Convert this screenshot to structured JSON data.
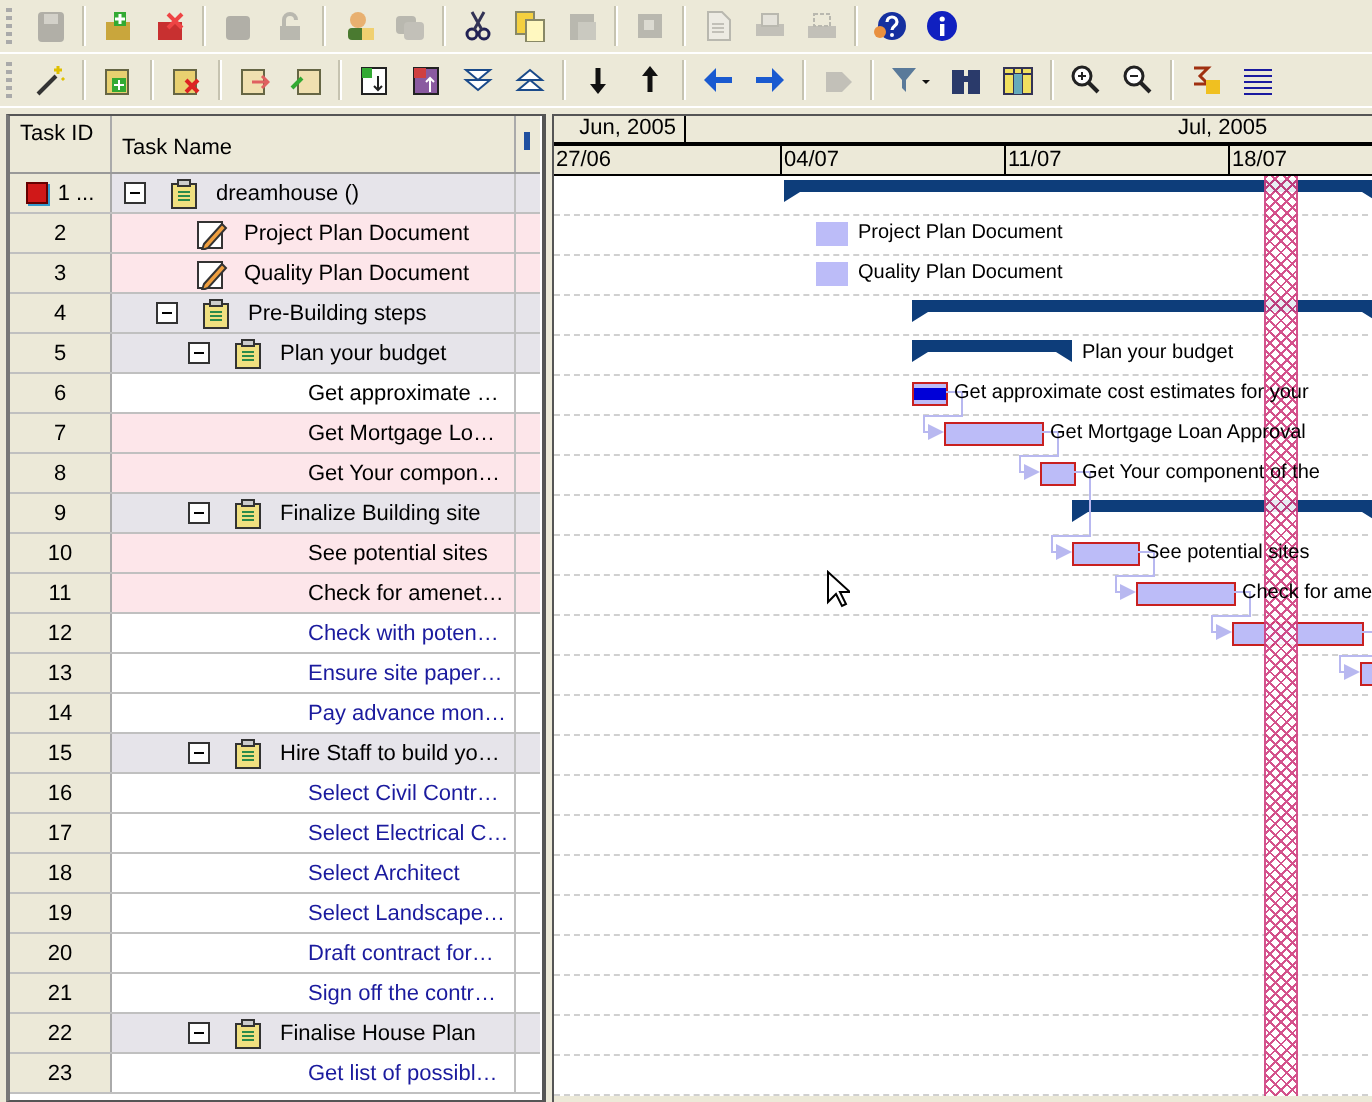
{
  "toolbars": [
    {
      "groups": [
        [
          {
            "disabled": true
          }
        ],
        [
          {
            "disabled": false
          },
          {
            "disabled": false
          }
        ],
        [
          {
            "disabled": true
          },
          {
            "disabled": true
          }
        ],
        [
          {
            "disabled": false
          },
          {
            "disabled": true
          }
        ],
        [
          {
            "disabled": false
          },
          {
            "disabled": false
          },
          {
            "disabled": true
          }
        ],
        [
          {
            "disabled": true
          }
        ],
        [
          {
            "disabled": true
          },
          {
            "disabled": true
          },
          {
            "disabled": true
          }
        ],
        [
          {
            "disabled": false
          },
          {
            "disabled": false
          }
        ]
      ]
    },
    {
      "groups": [
        [
          {
            "disabled": false
          }
        ],
        [
          {
            "disabled": false
          }
        ],
        [
          {
            "disabled": false
          }
        ],
        [
          {
            "disabled": false
          },
          {
            "disabled": false
          }
        ],
        [
          {
            "disabled": false
          },
          {
            "disabled": false
          },
          {
            "disabled": false
          },
          {
            "disabled": false
          }
        ],
        [
          {
            "disabled": false
          },
          {
            "disabled": false
          }
        ],
        [
          {
            "disabled": false
          },
          {
            "disabled": false
          }
        ],
        [
          {
            "disabled": true
          }
        ],
        [
          {
            "disabled": false
          },
          {
            "disabled": false
          },
          {
            "disabled": false
          }
        ],
        [
          {
            "disabled": false
          },
          {
            "disabled": false
          }
        ],
        [
          {
            "disabled": false
          },
          {
            "disabled": false
          }
        ]
      ]
    }
  ],
  "grid": {
    "columns": [
      "Task ID",
      "Task Name"
    ],
    "rows": [
      {
        "id": "1 ...",
        "name": "dreamhouse ()",
        "kind": "project",
        "pending": false,
        "expanded": true,
        "bar": {
          "kind": "summary"
        },
        "children": [
          {
            "id": "2",
            "name": "Project Plan Document",
            "kind": "document",
            "critical": true,
            "pending": false,
            "bar": {
              "kind": "document",
              "label": "Project Plan Document"
            }
          },
          {
            "id": "3",
            "name": "Quality Plan Document",
            "kind": "document",
            "critical": true,
            "pending": false,
            "bar": {
              "kind": "document",
              "label": "Quality Plan Document"
            }
          },
          {
            "id": "4",
            "name": "Pre-Building steps",
            "kind": "summary",
            "pending": false,
            "expanded": true,
            "bar": {
              "kind": "summary"
            },
            "children": [
              {
                "id": "5",
                "name": "Plan your budget",
                "kind": "summary",
                "pending": false,
                "expanded": true,
                "bar": {
                  "kind": "summary",
                  "label": "Plan your budget"
                },
                "children": [
                  {
                    "id": "6",
                    "name": "Get approximate …",
                    "kind": "task",
                    "critical": false,
                    "pending": false,
                    "bar": {
                      "kind": "task",
                      "level": 1,
                      "label": "Get approximate cost estimates for your"
                    }
                  },
                  {
                    "id": "7",
                    "name": "Get Mortgage Lo…",
                    "kind": "task",
                    "critical": true,
                    "pending": false,
                    "bar": {
                      "kind": "task",
                      "label": "Get Mortgage Loan Approval"
                    }
                  },
                  {
                    "id": "8",
                    "name": "Get Your compon…",
                    "kind": "task",
                    "critical": true,
                    "pending": false,
                    "bar": {
                      "kind": "task",
                      "label": "Get Your component of the"
                    }
                  }
                ]
              },
              {
                "id": "9",
                "name": "Finalize Building site",
                "kind": "summary",
                "pending": false,
                "expanded": true,
                "bar": {
                  "kind": "summary"
                },
                "children": [
                  {
                    "id": "10",
                    "name": "See potential sites",
                    "kind": "task",
                    "critical": true,
                    "pending": false,
                    "bar": {
                      "kind": "task",
                      "label": "See potential sites"
                    }
                  },
                  {
                    "id": "11",
                    "name": "Check for amenet…",
                    "kind": "task",
                    "critical": true,
                    "pending": false,
                    "bar": {
                      "kind": "task",
                      "label": "Check for ame"
                    }
                  },
                  {
                    "id": "12",
                    "name": "Check with poten…",
                    "kind": "task",
                    "critical": false,
                    "pending": true,
                    "bar": {
                      "kind": "task"
                    }
                  },
                  {
                    "id": "13",
                    "name": "Ensure site paper…",
                    "kind": "task",
                    "critical": false,
                    "pending": true,
                    "bar": {
                      "kind": "task"
                    }
                  },
                  {
                    "id": "14",
                    "name": "Pay advance mon…",
                    "kind": "task",
                    "critical": false,
                    "pending": true
                  }
                ]
              },
              {
                "id": "15",
                "name": "Hire Staff to build yo…",
                "kind": "summary",
                "pending": false,
                "expanded": true,
                "children": [
                  {
                    "id": "16",
                    "name": "Select Civil Contr…",
                    "kind": "task",
                    "critical": false,
                    "pending": true
                  },
                  {
                    "id": "17",
                    "name": "Select Electrical C…",
                    "kind": "task",
                    "critical": false,
                    "pending": true
                  },
                  {
                    "id": "18",
                    "name": "Select Architect",
                    "kind": "task",
                    "critical": false,
                    "pending": true
                  },
                  {
                    "id": "19",
                    "name": "Select Landscape…",
                    "kind": "task",
                    "critical": false,
                    "pending": true
                  },
                  {
                    "id": "20",
                    "name": "Draft contract for…",
                    "kind": "task",
                    "critical": false,
                    "pending": true
                  },
                  {
                    "id": "21",
                    "name": "Sign off the contr…",
                    "kind": "task",
                    "critical": false,
                    "pending": true
                  }
                ]
              },
              {
                "id": "22",
                "name": "Finalise House Plan",
                "kind": "summary",
                "pending": false,
                "expanded": true,
                "children": [
                  {
                    "id": "23",
                    "name": "Get list of possibl…",
                    "kind": "task",
                    "critical": false,
                    "pending": true
                  }
                ]
              }
            ]
          }
        ]
      }
    ]
  },
  "gantt": {
    "months": [
      "Jun, 2005",
      "Jul, 2005"
    ],
    "weeks": [
      "27/06",
      "04/07",
      "11/07",
      "18/07"
    ]
  }
}
